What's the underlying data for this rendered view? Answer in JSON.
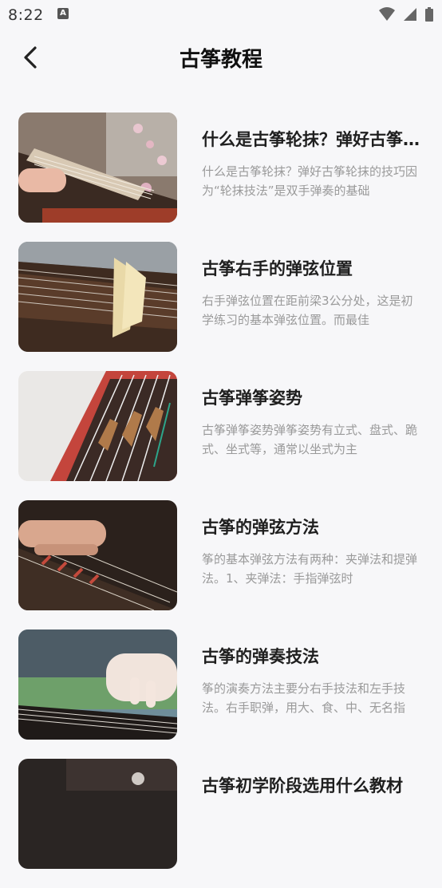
{
  "status_bar": {
    "time": "8:22",
    "notification_icon": "A"
  },
  "header": {
    "title": "古筝教程",
    "back_icon": "chevron-left-icon"
  },
  "articles": [
    {
      "title": "什么是古筝轮抹？弹好古筝轮抹的技巧",
      "desc": "什么是古筝轮抹？弹好古筝轮抹的技巧因为“轮抹技法”是双手弹奏的基础"
    },
    {
      "title": "古筝右手的弹弦位置",
      "desc": "右手弹弦位置在距前梁3公分处，这是初学练习的基本弹弦位置。而最佳"
    },
    {
      "title": "古筝弹筝姿势",
      "desc": "古筝弹筝姿势弹筝姿势有立式、盘式、跪式、坐式等，通常以坐式为主"
    },
    {
      "title": "古筝的弹弦方法",
      "desc": "筝的基本弹弦方法有两种：夹弹法和提弹法。1、夹弹法：手指弹弦时"
    },
    {
      "title": "古筝的弹奏技法",
      "desc": "筝的演奏方法主要分右手技法和左手技法。右手职弹，用大、食、中、无名指"
    },
    {
      "title": "古筝初学阶段选用什么教材",
      "desc": ""
    }
  ]
}
